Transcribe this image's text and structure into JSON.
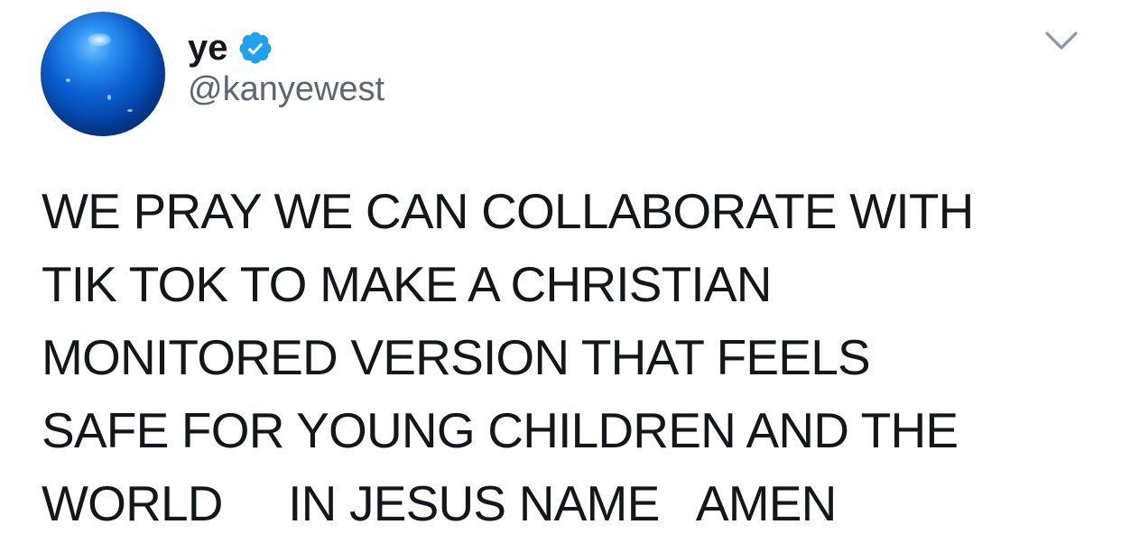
{
  "tweet": {
    "author": {
      "display_name": "ye",
      "handle": "@kanyewest",
      "verified": true,
      "avatar": "blue-sphere-avatar"
    },
    "menu_icon": "chevron-down-icon",
    "text_lines": [
      "WE PRAY WE CAN COLLABORATE WITH",
      "TIK TOK TO MAKE A CHRISTIAN",
      "MONITORED VERSION THAT FEELS",
      "SAFE FOR YOUNG CHILDREN AND THE",
      "WORLD     IN JESUS NAME   AMEN"
    ]
  },
  "colors": {
    "background": "#ffffff",
    "text": "#14171a",
    "secondary_text": "#5b6670",
    "verified_badge": "#1da1f2",
    "caret": "#8899a6"
  }
}
